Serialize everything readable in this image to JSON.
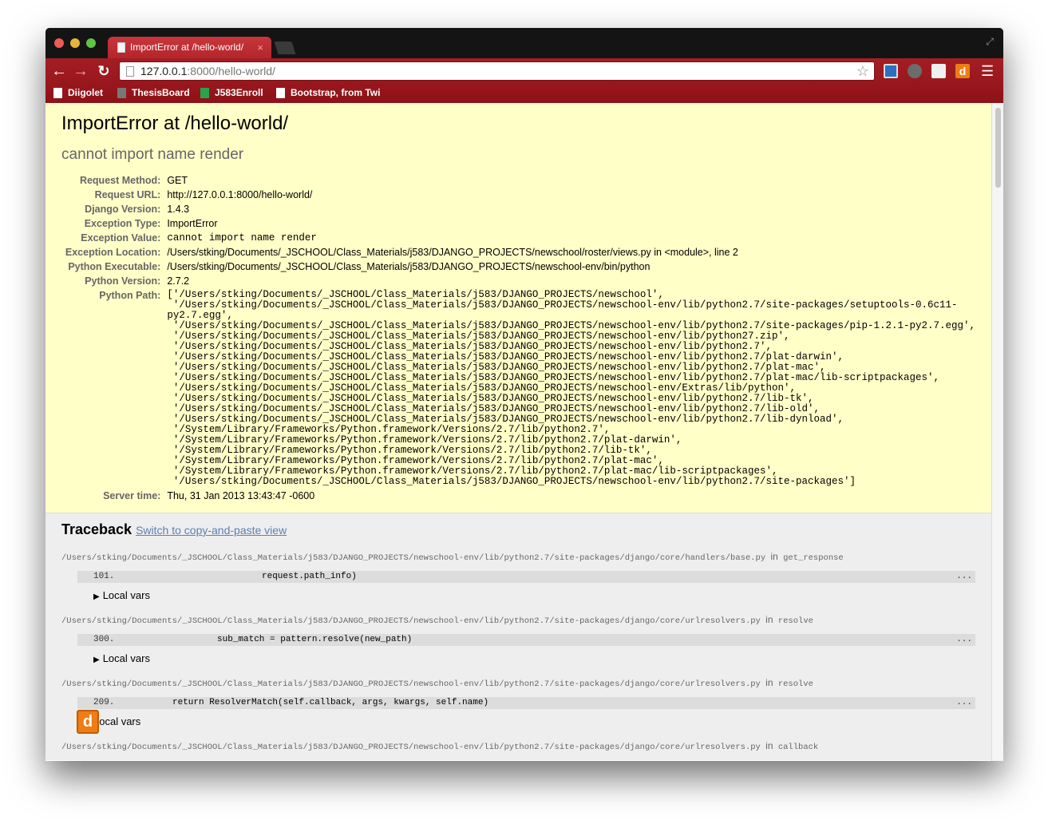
{
  "browser": {
    "tab_title": "ImportError at /hello-world/",
    "tab_close": "×",
    "url_host": "127.0.0.1",
    "url_rest": ":8000/hello-world/",
    "back_icon": "←",
    "forward_icon": "→",
    "reload_icon": "↻",
    "star_icon": "☆",
    "menu_icon": "☰",
    "ext_d_label": "d",
    "bookmarks": [
      {
        "label": "Diigolet"
      },
      {
        "label": "ThesisBoard"
      },
      {
        "label": "J583Enroll"
      },
      {
        "label": "Bootstrap, from Twi"
      }
    ]
  },
  "summary": {
    "title": "ImportError at /hello-world/",
    "message": "cannot import name render",
    "meta": [
      {
        "label": "Request Method:",
        "value": "GET"
      },
      {
        "label": "Request URL:",
        "value": "http://127.0.0.1:8000/hello-world/"
      },
      {
        "label": "Django Version:",
        "value": "1.4.3"
      },
      {
        "label": "Exception Type:",
        "value": "ImportError"
      },
      {
        "label": "Exception Value:",
        "value": "cannot import name render"
      },
      {
        "label": "Exception Location:",
        "value": "/Users/stking/Documents/_JSCHOOL/Class_Materials/j583/DJANGO_PROJECTS/newschool/roster/views.py in <module>, line 2"
      },
      {
        "label": "Python Executable:",
        "value": "/Users/stking/Documents/_JSCHOOL/Class_Materials/j583/DJANGO_PROJECTS/newschool-env/bin/python"
      },
      {
        "label": "Python Version:",
        "value": "2.7.2"
      },
      {
        "label": "Python Path:",
        "value": "['/Users/stking/Documents/_JSCHOOL/Class_Materials/j583/DJANGO_PROJECTS/newschool',\n '/Users/stking/Documents/_JSCHOOL/Class_Materials/j583/DJANGO_PROJECTS/newschool-env/lib/python2.7/site-packages/setuptools-0.6c11-\npy2.7.egg',\n '/Users/stking/Documents/_JSCHOOL/Class_Materials/j583/DJANGO_PROJECTS/newschool-env/lib/python2.7/site-packages/pip-1.2.1-py2.7.egg',\n '/Users/stking/Documents/_JSCHOOL/Class_Materials/j583/DJANGO_PROJECTS/newschool-env/lib/python27.zip',\n '/Users/stking/Documents/_JSCHOOL/Class_Materials/j583/DJANGO_PROJECTS/newschool-env/lib/python2.7',\n '/Users/stking/Documents/_JSCHOOL/Class_Materials/j583/DJANGO_PROJECTS/newschool-env/lib/python2.7/plat-darwin',\n '/Users/stking/Documents/_JSCHOOL/Class_Materials/j583/DJANGO_PROJECTS/newschool-env/lib/python2.7/plat-mac',\n '/Users/stking/Documents/_JSCHOOL/Class_Materials/j583/DJANGO_PROJECTS/newschool-env/lib/python2.7/plat-mac/lib-scriptpackages',\n '/Users/stking/Documents/_JSCHOOL/Class_Materials/j583/DJANGO_PROJECTS/newschool-env/Extras/lib/python',\n '/Users/stking/Documents/_JSCHOOL/Class_Materials/j583/DJANGO_PROJECTS/newschool-env/lib/python2.7/lib-tk',\n '/Users/stking/Documents/_JSCHOOL/Class_Materials/j583/DJANGO_PROJECTS/newschool-env/lib/python2.7/lib-old',\n '/Users/stking/Documents/_JSCHOOL/Class_Materials/j583/DJANGO_PROJECTS/newschool-env/lib/python2.7/lib-dynload',\n '/System/Library/Frameworks/Python.framework/Versions/2.7/lib/python2.7',\n '/System/Library/Frameworks/Python.framework/Versions/2.7/lib/python2.7/plat-darwin',\n '/System/Library/Frameworks/Python.framework/Versions/2.7/lib/python2.7/lib-tk',\n '/System/Library/Frameworks/Python.framework/Versions/2.7/lib/python2.7/plat-mac',\n '/System/Library/Frameworks/Python.framework/Versions/2.7/lib/python2.7/plat-mac/lib-scriptpackages',\n '/Users/stking/Documents/_JSCHOOL/Class_Materials/j583/DJANGO_PROJECTS/newschool-env/lib/python2.7/site-packages']"
      },
      {
        "label": "Server time:",
        "value": "Thu, 31 Jan 2013 13:43:47 -0600"
      }
    ]
  },
  "traceback": {
    "heading": "Traceback",
    "switch_link": "Switch to copy-and-paste view",
    "local_vars_label": "Local vars",
    "in_word": "in",
    "dots": "...",
    "frames": [
      {
        "file": "/Users/stking/Documents/_JSCHOOL/Class_Materials/j583/DJANGO_PROJECTS/newschool-env/lib/python2.7/site-packages/django/core/handlers/base.py",
        "func": "get_response",
        "line_no": "101.",
        "code": "request.path_info)"
      },
      {
        "file": "/Users/stking/Documents/_JSCHOOL/Class_Materials/j583/DJANGO_PROJECTS/newschool-env/lib/python2.7/site-packages/django/core/urlresolvers.py",
        "func": "resolve",
        "line_no": "300.",
        "code": "sub_match = pattern.resolve(new_path)"
      },
      {
        "file": "/Users/stking/Documents/_JSCHOOL/Class_Materials/j583/DJANGO_PROJECTS/newschool-env/lib/python2.7/site-packages/django/core/urlresolvers.py",
        "func": "resolve",
        "line_no": "209.",
        "code": "return ResolverMatch(self.callback, args, kwargs, self.name)"
      },
      {
        "file": "/Users/stking/Documents/_JSCHOOL/Class_Materials/j583/DJANGO_PROJECTS/newschool-env/lib/python2.7/site-packages/django/core/urlresolvers.py",
        "func": "callback"
      }
    ]
  }
}
